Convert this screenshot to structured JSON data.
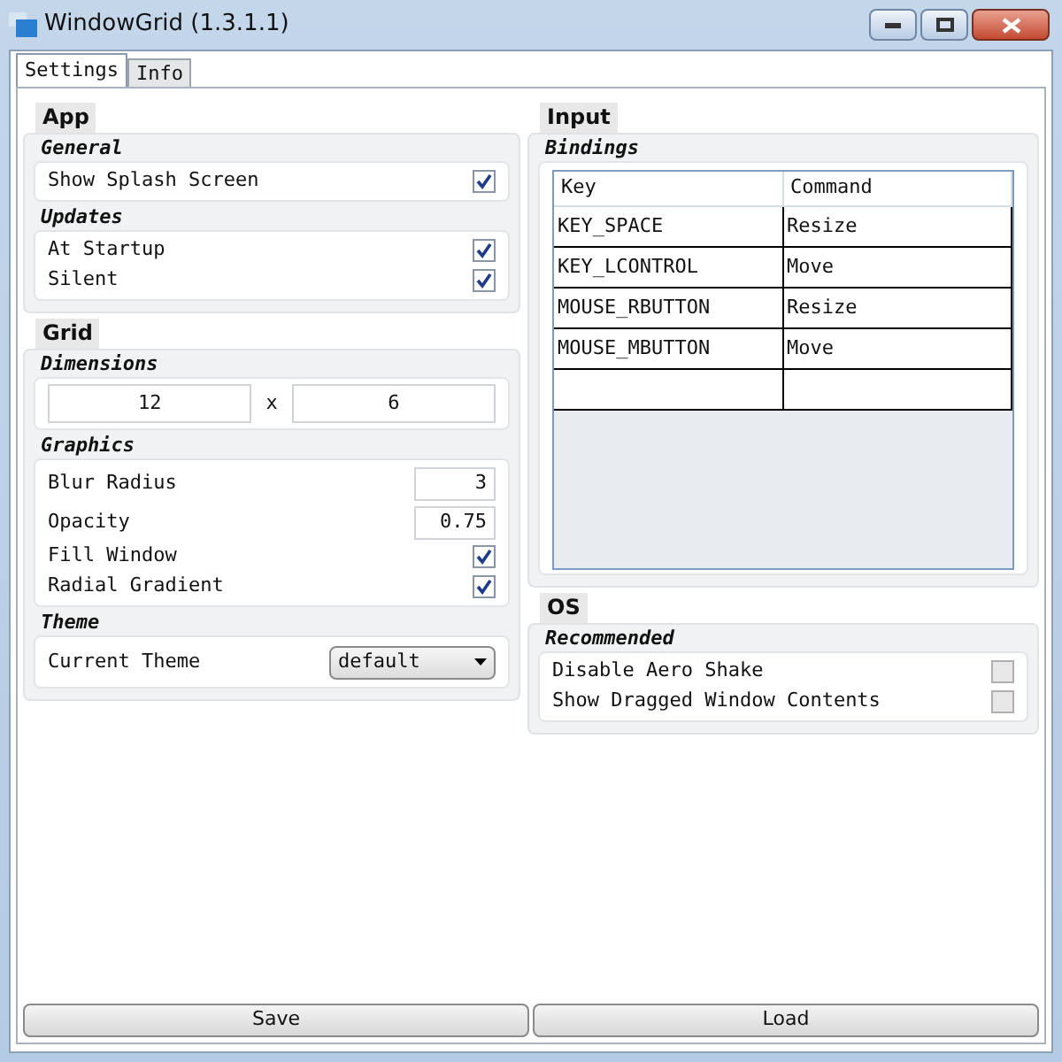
{
  "window": {
    "title": "WindowGrid (1.3.1.1)"
  },
  "tabs": [
    {
      "label": "Settings",
      "selected": true
    },
    {
      "label": "Info",
      "selected": false
    }
  ],
  "columns": [
    [
      {
        "title": "App",
        "groups": [
          {
            "title": "General",
            "rows": [
              {
                "kind": "checkbox",
                "label": "Show Splash Screen",
                "checked": true
              }
            ]
          },
          {
            "title": "Updates",
            "rows": [
              {
                "kind": "checkbox",
                "label": "At Startup",
                "checked": true
              },
              {
                "kind": "checkbox",
                "label": "Silent",
                "checked": true
              }
            ]
          }
        ]
      },
      {
        "title": "Grid",
        "groups": [
          {
            "title": "Dimensions",
            "rows": [
              {
                "kind": "pair",
                "first": "12",
                "separator": "x",
                "second": "6"
              }
            ]
          },
          {
            "title": "Graphics",
            "rows": [
              {
                "kind": "number",
                "label": "Blur Radius",
                "value": "3"
              },
              {
                "kind": "number",
                "label": "Opacity",
                "value": "0.75"
              },
              {
                "kind": "checkbox",
                "label": "Fill Window",
                "checked": true
              },
              {
                "kind": "checkbox",
                "label": "Radial Gradient",
                "checked": true
              }
            ]
          },
          {
            "title": "Theme",
            "rows": [
              {
                "kind": "dropdown",
                "label": "Current Theme",
                "value": "default"
              }
            ]
          }
        ]
      }
    ],
    [
      {
        "title": "Input",
        "groups": [
          {
            "title": "Bindings",
            "rows": [
              {
                "kind": "table",
                "columns": [
                  "Key",
                  "Command"
                ],
                "cells": [
                  [
                    "KEY_SPACE",
                    "Resize"
                  ],
                  [
                    "KEY_LCONTROL",
                    "Move"
                  ],
                  [
                    "MOUSE_RBUTTON",
                    "Resize"
                  ],
                  [
                    "MOUSE_MBUTTON",
                    "Move"
                  ]
                ]
              }
            ]
          }
        ]
      },
      {
        "title": "OS",
        "groups": [
          {
            "title": "Recommended",
            "rows": [
              {
                "kind": "checkbox",
                "label": "Disable Aero Shake",
                "checked": false
              },
              {
                "kind": "checkbox",
                "label": "Show Dragged Window Contents",
                "checked": false
              }
            ]
          }
        ]
      }
    ]
  ],
  "buttons": [
    "Save",
    "Load"
  ]
}
